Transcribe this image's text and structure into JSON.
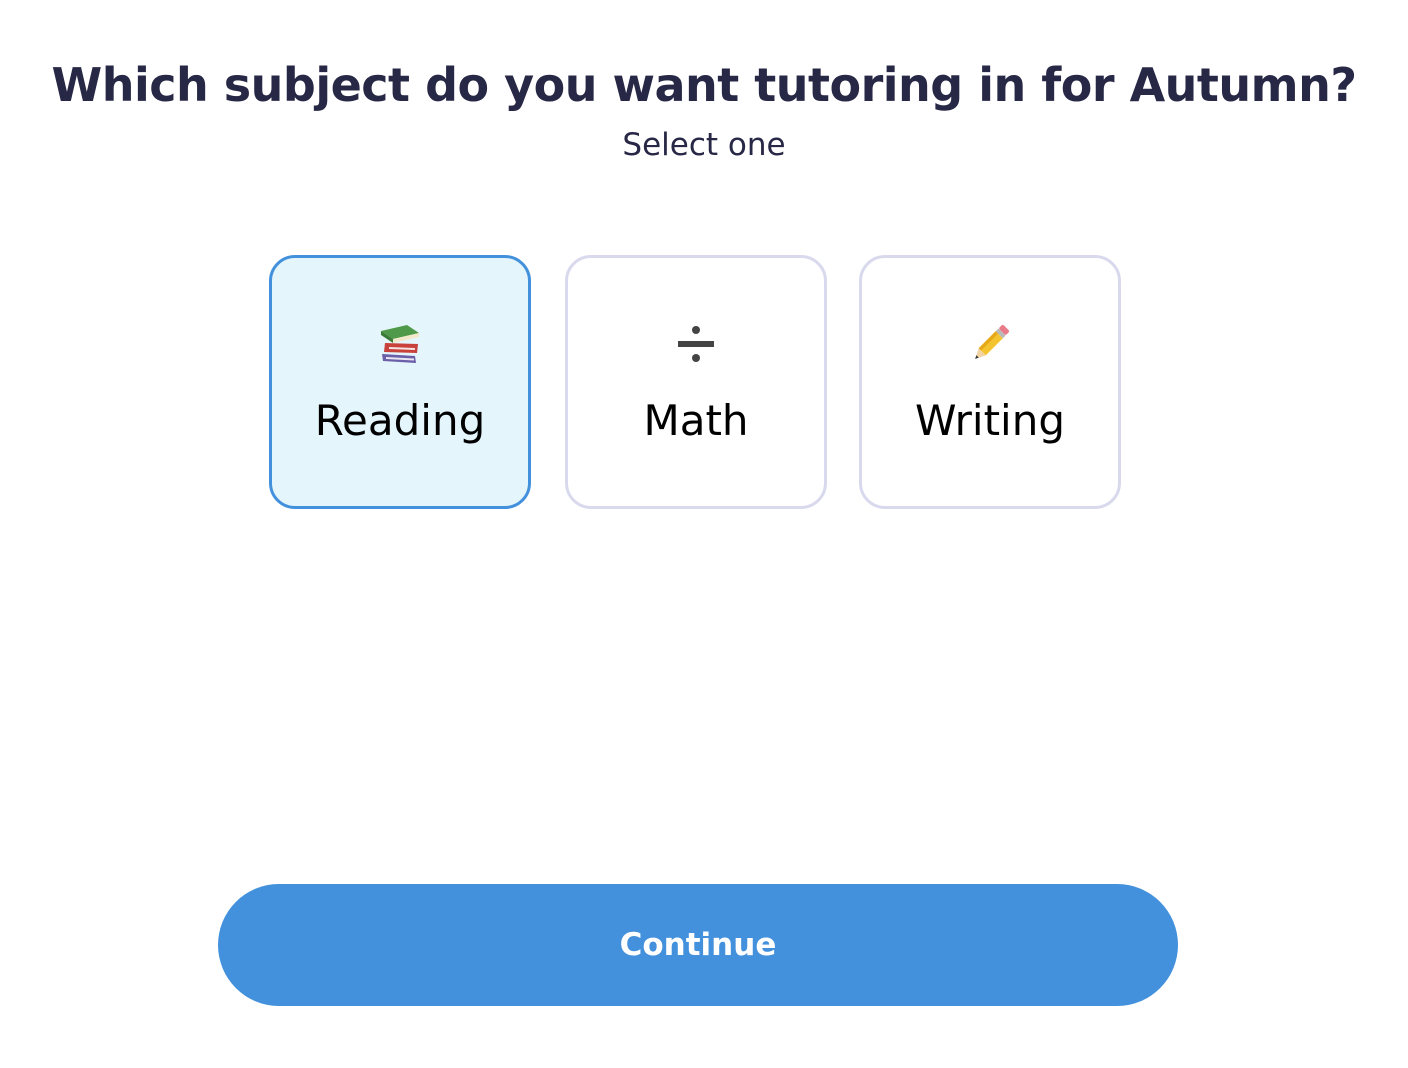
{
  "header": {
    "title": "Which subject do you want tutoring in for Autumn?",
    "subtitle": "Select one"
  },
  "options": [
    {
      "label": "Reading",
      "icon": "books-icon",
      "selected": true
    },
    {
      "label": "Math",
      "icon": "division-sign-icon",
      "selected": false
    },
    {
      "label": "Writing",
      "icon": "pencil-icon",
      "selected": false
    }
  ],
  "footer": {
    "continue_label": "Continue"
  },
  "colors": {
    "title_text": "#272746",
    "accent": "#4391dc",
    "selected_background": "#e4f5fc",
    "card_border": "#d9d9ee"
  }
}
